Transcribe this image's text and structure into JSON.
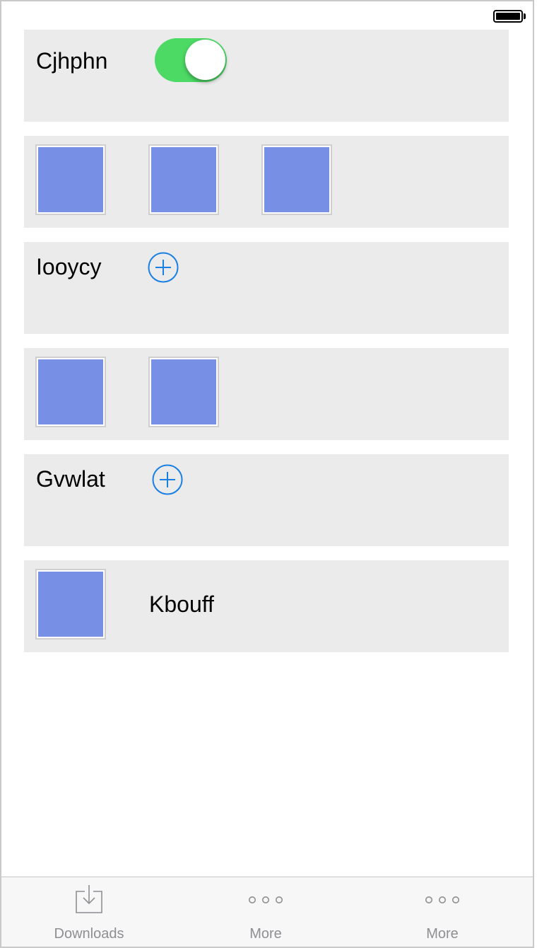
{
  "status_bar": {
    "battery_icon": "battery-full-icon"
  },
  "rows": {
    "row1": {
      "label": "Cjhphn",
      "toggle_state": "on",
      "toggle_color": "#4cd964"
    },
    "row2": {
      "thumbnail_count": 3
    },
    "row3": {
      "label": "Iooycy",
      "add_icon": "plus-circle-icon",
      "accent": "#1a7fe3"
    },
    "row4": {
      "thumbnail_count": 2
    },
    "row5": {
      "label": "Gvwlat",
      "add_icon": "plus-circle-icon",
      "accent": "#1a7fe3"
    },
    "row6": {
      "label": "Kbouff"
    }
  },
  "colors": {
    "panel": "#ebebeb",
    "thumbnail": "#7790e6"
  },
  "tab_bar": {
    "tabs": [
      {
        "label": "Downloads",
        "icon": "downloads-icon"
      },
      {
        "label": "More",
        "icon": "more-dots-icon"
      },
      {
        "label": "More",
        "icon": "more-dots-icon"
      }
    ]
  }
}
